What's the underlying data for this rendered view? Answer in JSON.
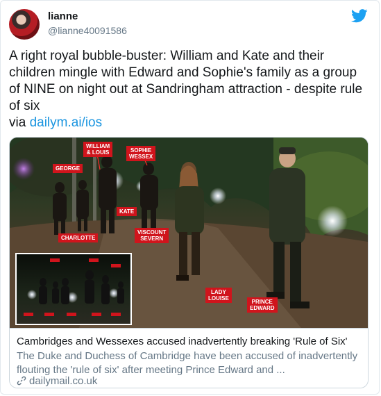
{
  "user": {
    "name": "lianne",
    "handle": "@lianne40091586"
  },
  "tweet": {
    "text": "A right royal bubble-buster: William and Kate and their children mingle with Edward and Sophie's family as a group of NINE on night out at Sandringham attraction - despite rule of six",
    "via_prefix": "via ",
    "link": "dailym.ai/ios"
  },
  "photo_labels": {
    "william_louis": "WILLIAM\n& LOUIS",
    "sophie_wessex": "SOPHIE\nWESSEX",
    "george": "GEORGE",
    "kate": "KATE",
    "charlotte": "CHARLOTTE",
    "viscount_severn": "VISCOUNT\nSEVERN",
    "lady_louise": "LADY\nLOUISE",
    "prince_edward": "PRINCE\nEDWARD"
  },
  "link_card": {
    "title": "Cambridges and Wessexes accused inadvertently breaking 'Rule of Six'",
    "description": "The Duke and Duchess of Cambridge have been accused of inadvertently flouting the 'rule of six' after meeting Prince Edward and ...",
    "domain": "dailymail.co.uk"
  },
  "icons": {
    "brand": "twitter-bird-icon",
    "link": "link-icon"
  },
  "colors": {
    "link": "#1b95e0",
    "brand": "#1da1f2",
    "label": "#d0141c"
  }
}
